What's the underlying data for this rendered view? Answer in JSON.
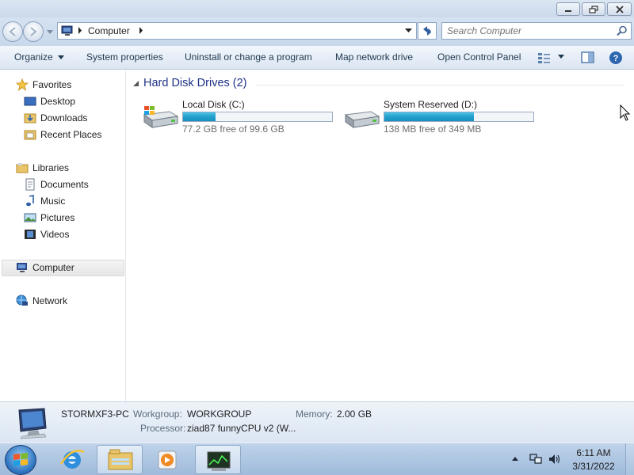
{
  "window": {
    "caption_buttons": [
      "minimize",
      "maximize",
      "close"
    ]
  },
  "address_bar": {
    "location": "Computer",
    "search_placeholder": "Search Computer"
  },
  "command_bar": {
    "organize": "Organize",
    "system_properties": "System properties",
    "uninstall": "Uninstall or change a program",
    "map_drive": "Map network drive",
    "control_panel": "Open Control Panel"
  },
  "nav_pane": {
    "favorites": "Favorites",
    "desktop": "Desktop",
    "downloads": "Downloads",
    "recent_places": "Recent Places",
    "libraries": "Libraries",
    "documents": "Documents",
    "music": "Music",
    "pictures": "Pictures",
    "videos": "Videos",
    "computer": "Computer",
    "network": "Network",
    "selected": "Computer"
  },
  "content": {
    "group_title": "Hard Disk Drives (2)",
    "drives": [
      {
        "name": "Local Disk (C:)",
        "free_text": "77.2 GB free of 99.6 GB",
        "used_fraction": 0.22,
        "icon": "windows-drive-icon"
      },
      {
        "name": "System Reserved (D:)",
        "free_text": "138 MB free of 349 MB",
        "used_fraction": 0.6,
        "icon": "drive-icon"
      }
    ]
  },
  "details": {
    "computer_name": "STORMXF3-PC",
    "workgroup_label": "Workgroup:",
    "workgroup_value": "WORKGROUP",
    "memory_label": "Memory:",
    "memory_value": "2.00 GB",
    "processor_label": "Processor:",
    "processor_value": "ziad87 funnyCPU v2 (W..."
  },
  "taskbar": {
    "pinned": [
      "internet-explorer-icon",
      "explorer-icon",
      "media-player-icon",
      "task-manager-icon"
    ],
    "clock_time": "6:11 AM",
    "clock_date": "3/31/2022"
  },
  "colors": {
    "accent_blue": "#1e3287",
    "bar_fill": "#24a0cd",
    "chrome": "#c8d8eb"
  }
}
